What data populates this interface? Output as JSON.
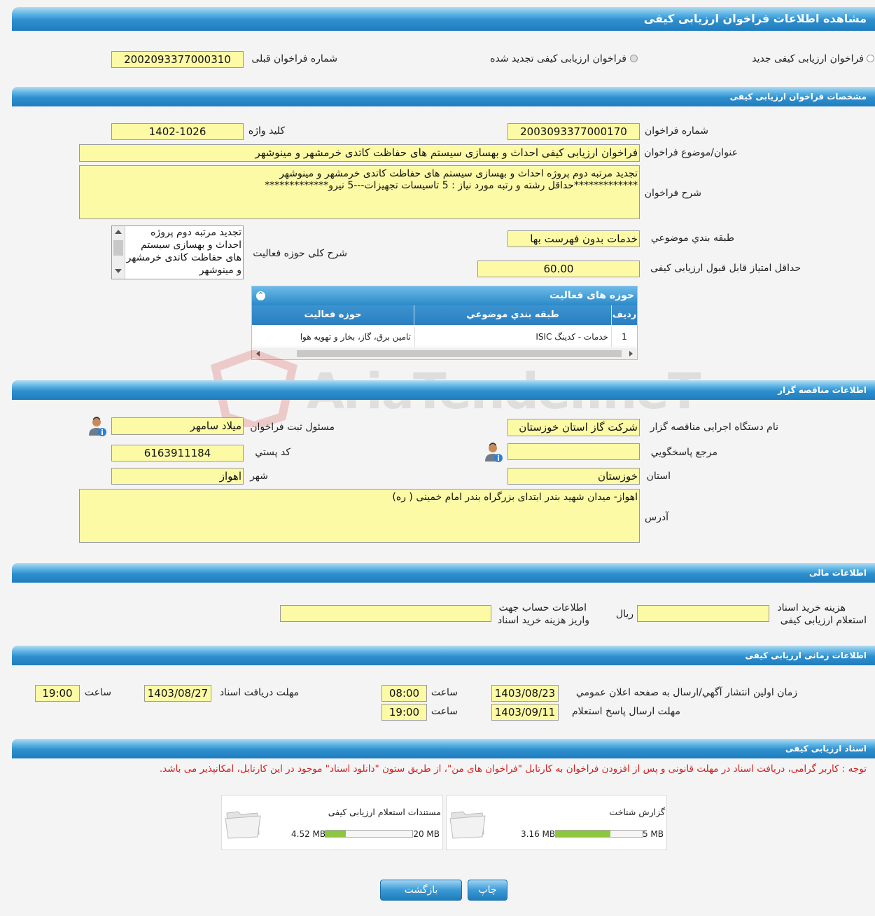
{
  "page": {
    "title": "مشاهده اطلاعات فراخوان ارزیابی کیفی"
  },
  "top": {
    "radio_new": "فراخوان ارزیابی کیفی جدید",
    "radio_renewed": "فراخوان ارزیابی کیفی تجدید شده",
    "prev_label": "شماره فراخوان قبلی",
    "prev_value": "2002093377000310"
  },
  "spec": {
    "header": "مشخصات فراخوان ارزيابی کيفی",
    "number_label": "شماره فراخوان",
    "number_value": "2003093377000170",
    "keyword_label": "کلید واژه",
    "keyword_value": "1402-1026",
    "subject_label": "عنوان/موضوع فراخوان",
    "subject_value": "فراخوان ارزیابی کیفی احداث و بهسازی سیستم های حفاظت کاتدی خرمشهر و مینوشهر",
    "desc_label": "شرح فراخوان",
    "desc_value": "تجدید مرتبه دوم پروژه احداث و بهسازی سیستم های حفاظت کاتدی خرمشهر و مینوشهر\n*************حداقل رشته و رتبه مورد نیاز : 5 تاسیسات تجهیزات---5 نیرو*************",
    "category_label": "طبقه بندي موضوعي",
    "category_value": "خدمات بدون فهرست بها",
    "activity_label": "شرح کلی حوزه فعالیت",
    "activity_value": "تجدید مرتبه دوم پروژه احداث و بهسازی سیستم های حفاظت کاتدی خرمشهر و مینوشهر",
    "minscore_label": "حداقل امتیاز قابل قبول ارزیابی کیفی",
    "minscore_value": "60.00"
  },
  "activity_grid": {
    "title": "حوزه های فعالیت",
    "columns": [
      "رديف",
      "طبقه بندي موضوعي",
      "حوزه فعالیت"
    ],
    "rows": [
      [
        "1",
        "خدمات - کدینگ ISIC",
        "تامین برق، گاز، بخار و تهویه هوا"
      ]
    ]
  },
  "watermark": "AriaTender.neT",
  "organizer": {
    "header": "اطلاعات مناقصه گزار",
    "org_label": "نام دستگاه اجرایی مناقصه گزار",
    "org_value": "شرکت گاز استان خوزستان",
    "registrar_label": "مسئول ثبت فراخوان",
    "registrar_value": "میلاد سامهر",
    "ref_label": "مرجع پاسخگويي",
    "ref_value": "",
    "postal_label": "کد پستي",
    "postal_value": "6163911184",
    "province_label": "استان",
    "province_value": "خوزستان",
    "city_label": "شهر",
    "city_value": "اهواز",
    "address_label": "آدرس",
    "address_value": "اهواز- میدان شهید بندر ابتدای بزرگراه بندر امام خمینی ( ره)"
  },
  "finance": {
    "header": "اطلاعات مالی",
    "fee_label_1": "هزینه خرید اسناد",
    "fee_label_2": "استعلام ارزيابی کيفی",
    "fee_value": "",
    "rial": "ريال",
    "account_label_1": "اطلاعات حساب جهت",
    "account_label_2": "واريز هزینه خرید اسناد",
    "account_value": ""
  },
  "timing": {
    "header": "اطلاعات زمانی ارزيابی کيفی",
    "publish_label": "زمان اولین انتشار آگهي/ارسال به صفحه اعلان عمومي",
    "publish_date": "1403/08/23",
    "time_label": "ساعت",
    "publish_time": "08:00",
    "deadline_label": "مهلت دريافت اسناد",
    "deadline_date": "1403/08/27",
    "deadline_time": "19:00",
    "reply_label": "مهلت ارسال پاسخ استعلام",
    "reply_date": "1403/09/11",
    "reply_time": "19:00"
  },
  "docs": {
    "header": "اسناد ارزیابی کیفی",
    "notice": "توجه : کاربر گرامی، دریافت اسناد در مهلت قانونی و پس از افزودن فراخوان به کارتابل \"فراخوان های من\"، از طریق ستون \"دانلود اسناد\" موجود در این کارتابل، امکانپذیر می باشد.",
    "files": [
      {
        "name": "گزارش شناخت",
        "size": "3.16 MB",
        "max": "5 MB",
        "fill": 0.63
      },
      {
        "name": "مستندات استعلام ارزيابی کيفی",
        "size": "4.52 MB",
        "max": "20 MB",
        "fill": 0.23
      }
    ]
  },
  "buttons": {
    "print": "چاپ",
    "back": "بازگشت"
  },
  "colors": {
    "header_blue": "#1f7dbd",
    "field_yellow": "#fdfaa6",
    "notice_red": "#d42020",
    "progress_green": "#8dc63f"
  }
}
